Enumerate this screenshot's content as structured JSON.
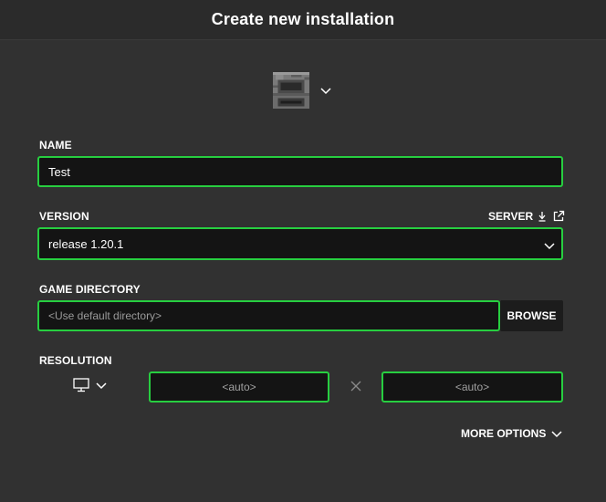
{
  "header": {
    "title": "Create new installation"
  },
  "icon_picker": {
    "icon": "furnace-icon",
    "chevron": "chevron-down-icon"
  },
  "name": {
    "label": "NAME",
    "value": "Test"
  },
  "version": {
    "label": "VERSION",
    "value": "release 1.20.1",
    "server_link": "SERVER",
    "server_icons": [
      "download-icon",
      "external-link-icon"
    ]
  },
  "game_directory": {
    "label": "GAME DIRECTORY",
    "placeholder": "<Use default directory>",
    "browse_label": "BROWSE"
  },
  "resolution": {
    "label": "RESOLUTION",
    "width_placeholder": "<auto>",
    "height_placeholder": "<auto>",
    "monitor_icon": "monitor-icon",
    "separator_icon": "times-icon"
  },
  "more_options": {
    "label": "MORE OPTIONS"
  },
  "colors": {
    "background": "#313131",
    "header": "#2b2b2b",
    "field": "#141414",
    "accent": "#27ce40",
    "text": "#ffffff",
    "muted": "#9a9a9a"
  }
}
